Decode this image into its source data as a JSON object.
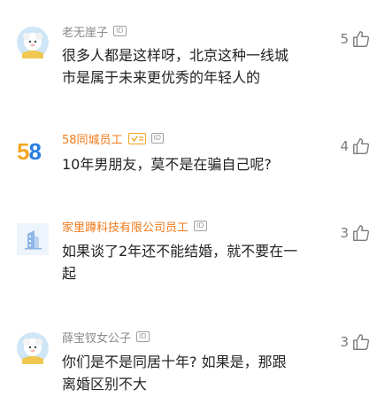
{
  "comments": [
    {
      "username": "老无崖子",
      "badge": "ID",
      "text_lines": [
        "很多人都是这样呀，北京这种一线城",
        "市是属于未来更优秀的年轻人的"
      ],
      "likes": "5",
      "avatar": "sheep-avatar-icon"
    },
    {
      "username": "58同城员工",
      "badge": "ID",
      "text_lines": [
        "10年男朋友，莫不是在骗自己呢?"
      ],
      "likes": "4",
      "avatar_text": "58",
      "avatar_colors": [
        "#f5a623",
        "#e8352e",
        "#2a7de1"
      ]
    },
    {
      "username": "家里蹲科技有限公司员工",
      "badge": "ID",
      "text_lines": [
        "如果谈了2年还不能结婚，就不要在一",
        "起"
      ],
      "likes": "3",
      "avatar": "building-icon"
    },
    {
      "username": "薛宝钗女公子",
      "badge": "ID",
      "text_lines": [
        "你们是不是同居十年? 如果是，那跟",
        "离婚区别不大"
      ],
      "likes": "3",
      "avatar": "sheep-avatar-icon"
    }
  ],
  "colors": {
    "text": "#222222",
    "username": "#8a8a8a",
    "username_company": "#f07a1a",
    "like": "#7a7a7a"
  }
}
